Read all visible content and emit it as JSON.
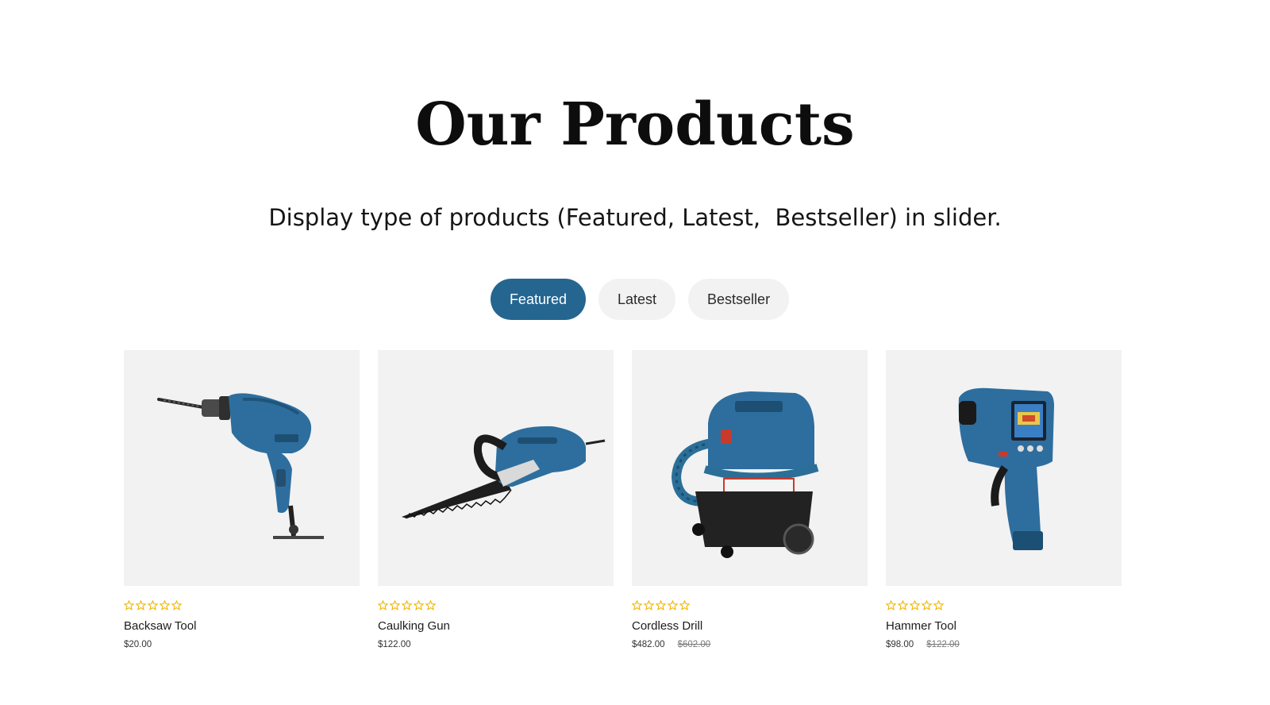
{
  "section": {
    "title": "Our Products",
    "subtitle": "Display type of products (Featured, Latest,  Bestseller) in slider."
  },
  "tabs": [
    {
      "label": "Featured",
      "active": true
    },
    {
      "label": "Latest",
      "active": false
    },
    {
      "label": "Bestseller",
      "active": false
    }
  ],
  "colors": {
    "accent": "#246690",
    "star": "#f2b600",
    "card_bg": "#f2f2f2"
  },
  "products": [
    {
      "name": "Backsaw Tool",
      "price": "$20.00",
      "old_price": "",
      "rating": 0,
      "image_icon": "power-drill-icon"
    },
    {
      "name": "Caulking Gun",
      "price": "$122.00",
      "old_price": "",
      "rating": 0,
      "image_icon": "reciprocating-saw-icon"
    },
    {
      "name": "Cordless Drill",
      "price": "$482.00",
      "old_price": "$602.00",
      "rating": 0,
      "image_icon": "wet-dry-vacuum-icon"
    },
    {
      "name": "Hammer Tool",
      "price": "$98.00",
      "old_price": "$122.00",
      "rating": 0,
      "image_icon": "thermal-detector-icon"
    }
  ]
}
